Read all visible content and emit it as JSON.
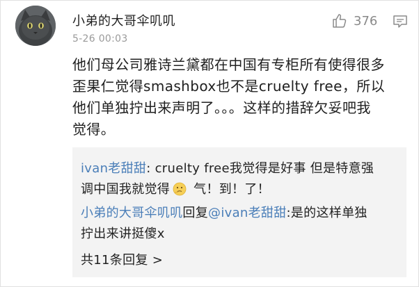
{
  "comment": {
    "username": "小弟的大哥伞叽叽",
    "timestamp": "5-26 00:03",
    "like_count": "376",
    "content_lines": [
      "他们母公司雅诗兰黛都在中国有专柜所有使得很多",
      "歪果仁觉得smashbox也不是cruelty free，所以",
      "他们单独拧出来声明了。。。这样的措辞欠妥吧我",
      "觉得。"
    ]
  },
  "replies": {
    "reply1": {
      "username": "ivan老甜甜",
      "text_part1": ": cruelty free我觉得是好事 但是特意强",
      "text_part2a": "调中国我就觉得",
      "text_part2b": " 气！到！了！",
      "emoji": "thinking-face-emoji"
    },
    "reply2": {
      "username": "小弟的大哥伞叽叽",
      "reply_word": "回复",
      "mention": "@ivan老甜甜",
      "text_part1": ":是的这样单独",
      "text_part2": "拧出来讲挺傻x"
    },
    "more_label": "共11条回复 >"
  },
  "colors": {
    "link": "#4a7eb8",
    "reply_bg": "#f3f3f3",
    "meta": "#9a9a9a"
  }
}
